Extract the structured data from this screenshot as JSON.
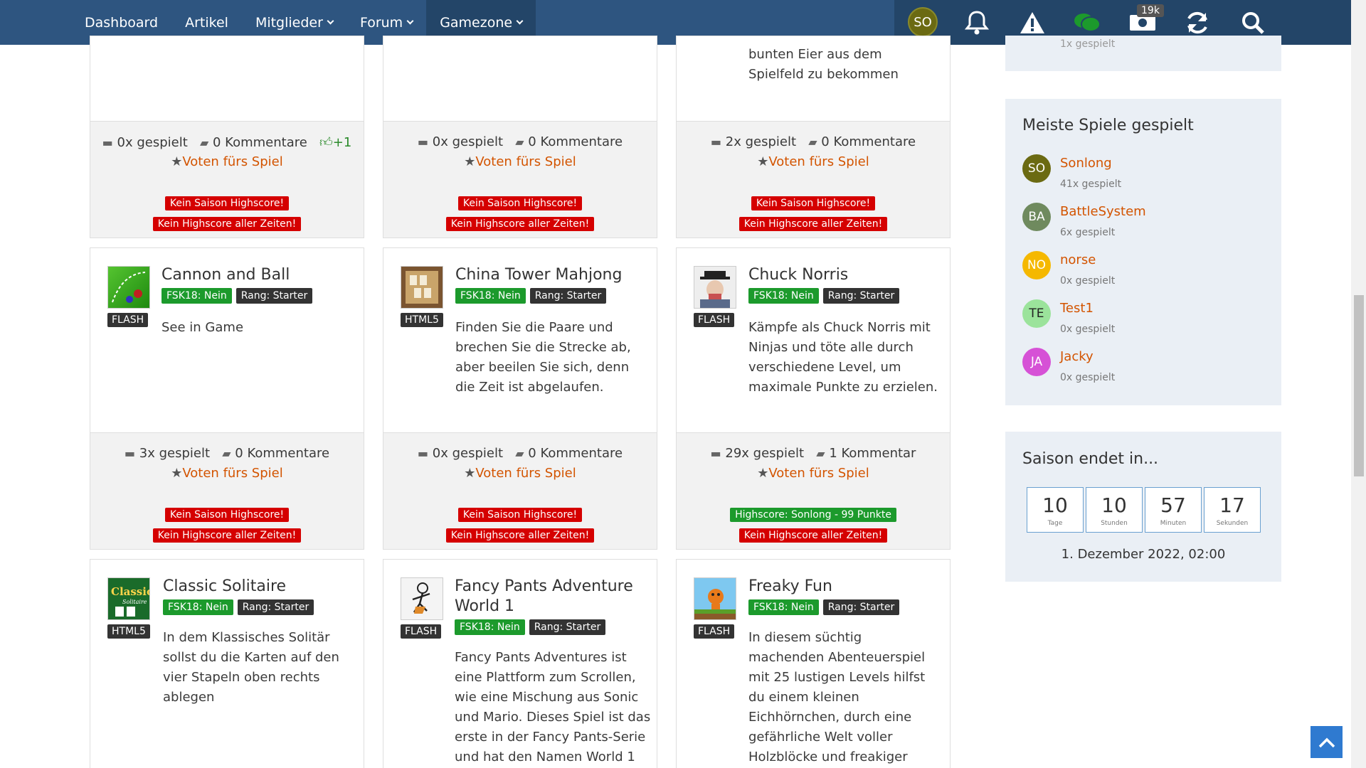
{
  "nav": {
    "items": [
      {
        "label": "Dashboard",
        "caret": false,
        "active": false
      },
      {
        "label": "Artikel",
        "caret": false,
        "active": false
      },
      {
        "label": "Mitglieder",
        "caret": true,
        "active": false
      },
      {
        "label": "Forum",
        "caret": true,
        "active": false
      },
      {
        "label": "Gamezone",
        "caret": true,
        "active": true
      }
    ],
    "user_initials": "SO",
    "badge": "19k"
  },
  "top_row": [
    {
      "desc": "",
      "stats": {
        "played": "0x gespielt",
        "comments": "0 Kommentare",
        "likes": "+1"
      },
      "vote": "Voten fürs Spiel",
      "hs_season": "Kein Saison Highscore!",
      "hs_all": "Kein Highscore aller Zeiten!"
    },
    {
      "desc": "",
      "stats": {
        "played": "0x gespielt",
        "comments": "0 Kommentare",
        "likes": ""
      },
      "vote": "Voten fürs Spiel",
      "hs_season": "Kein Saison Highscore!",
      "hs_all": "Kein Highscore aller Zeiten!"
    },
    {
      "desc": "bunten Eier aus dem Spielfeld zu bekommen",
      "stats": {
        "played": "2x gespielt",
        "comments": "0 Kommentare",
        "likes": ""
      },
      "vote": "Voten fürs Spiel",
      "hs_season": "Kein Saison Highscore!",
      "hs_all": "Kein Highscore aller Zeiten!"
    }
  ],
  "mid_row": [
    {
      "title": "Cannon and Ball",
      "type": "FLASH",
      "fsk": "FSK18: Nein",
      "rank": "Rang: Starter",
      "desc": "See in Game",
      "stats": {
        "played": "3x gespielt",
        "comments": "0 Kommentare"
      },
      "vote": "Voten fürs Spiel",
      "hs_season": "Kein Saison Highscore!",
      "hs_all": "Kein Highscore aller Zeiten!"
    },
    {
      "title": "China Tower Mahjong",
      "type": "HTML5",
      "fsk": "FSK18: Nein",
      "rank": "Rang: Starter",
      "desc": "Finden Sie die Paare und brechen Sie die Strecke ab, aber beeilen Sie sich, denn die Zeit ist abgelaufen.",
      "stats": {
        "played": "0x gespielt",
        "comments": "0 Kommentare"
      },
      "vote": "Voten fürs Spiel",
      "hs_season": "Kein Saison Highscore!",
      "hs_all": "Kein Highscore aller Zeiten!"
    },
    {
      "title": "Chuck Norris",
      "type": "FLASH",
      "fsk": "FSK18: Nein",
      "rank": "Rang: Starter",
      "desc": "Kämpfe als Chuck Norris mit Ninjas und töte alle durch verschiedene Level, um maximale Punkte zu erzielen.",
      "stats": {
        "played": "29x gespielt",
        "comments": "1 Kommentar"
      },
      "vote": "Voten fürs Spiel",
      "hs_season": "Highscore: Sonlong - 99 Punkte",
      "hs_all": "Kein Highscore aller Zeiten!"
    }
  ],
  "bottom_row": [
    {
      "title": "Classic Solitaire",
      "type": "HTML5",
      "fsk": "FSK18: Nein",
      "rank": "Rang: Starter",
      "desc": "In dem Klassisches Solitär sollst du die Karten auf den vier Stapeln oben rechts ablegen"
    },
    {
      "title": "Fancy Pants Adventure World 1",
      "type": "FLASH",
      "fsk": "FSK18: Nein",
      "rank": "Rang: Starter",
      "desc": "Fancy Pants Adventures ist eine Plattform zum Scrollen, wie eine Mischung aus Sonic und Mario. Dieses Spiel ist das erste in der Fancy Pants-Serie und hat den Namen World 1"
    },
    {
      "title": "Freaky Fun",
      "type": "FLASH",
      "fsk": "FSK18: Nein",
      "rank": "Rang: Starter",
      "desc": "In diesem süchtig machenden Abenteuerspiel mit 25 lustigen Levels hilfst du einem kleinen Eichhörnchen, durch eine gefährliche Welt voller Holzblöcke und freakiger Kreaturen nach Hause zu"
    }
  ],
  "sidebar": {
    "top_partial": "1x gespielt",
    "most_played": {
      "title": "Meiste Spiele gespielt",
      "players": [
        {
          "initials": "SO",
          "name": "Sonlong",
          "count": "41x gespielt",
          "color": "#6b6a12",
          "text_color": "#ffffff"
        },
        {
          "initials": "BA",
          "name": "BattleSystem",
          "count": "6x gespielt",
          "color": "#6f8a5e",
          "text_color": "#ffffff"
        },
        {
          "initials": "NO",
          "name": "norse",
          "count": "0x gespielt",
          "color": "#f5b800",
          "text_color": "#ffffff"
        },
        {
          "initials": "TE",
          "name": "Test1",
          "count": "0x gespielt",
          "color": "#9be39b",
          "text_color": "#222222"
        },
        {
          "initials": "JA",
          "name": "Jacky",
          "count": "0x gespielt",
          "color": "#d651d6",
          "text_color": "#ffffff"
        }
      ]
    },
    "season": {
      "title": "Saison endet in...",
      "units": [
        {
          "value": "10",
          "label": "Tage"
        },
        {
          "value": "10",
          "label": "Stunden"
        },
        {
          "value": "57",
          "label": "Minuten"
        },
        {
          "value": "17",
          "label": "Sekunden"
        }
      ],
      "date": "1. Dezember 2022, 02:00"
    }
  }
}
